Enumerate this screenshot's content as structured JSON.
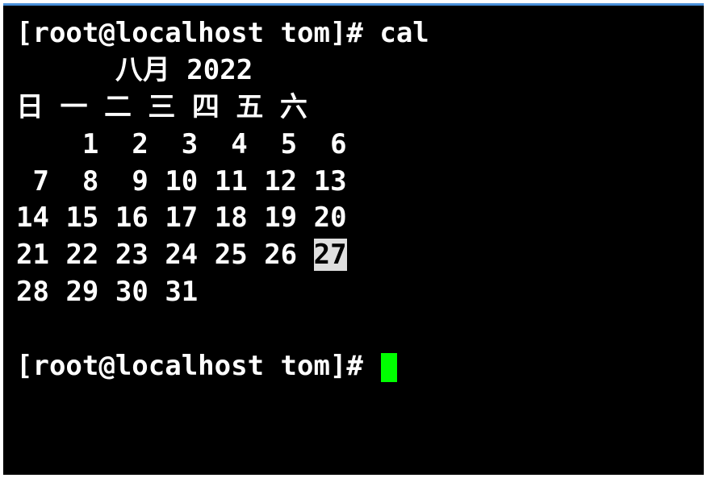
{
  "prompt1": {
    "text": "[root@localhost tom]# ",
    "command": "cal"
  },
  "calendar": {
    "title": "      八月 2022",
    "weekdays": "日 一 二 三 四 五 六",
    "rows": [
      [
        "  ",
        " 1",
        " 2",
        " 3",
        " 4",
        " 5",
        " 6"
      ],
      [
        " 7",
        " 8",
        " 9",
        "10",
        "11",
        "12",
        "13"
      ],
      [
        "14",
        "15",
        "16",
        "17",
        "18",
        "19",
        "20"
      ],
      [
        "21",
        "22",
        "23",
        "24",
        "25",
        "26",
        "27"
      ],
      [
        "28",
        "29",
        "30",
        "31",
        "  ",
        "  ",
        "  "
      ]
    ],
    "today": "27"
  },
  "prompt2": {
    "text": "[root@localhost tom]# "
  }
}
